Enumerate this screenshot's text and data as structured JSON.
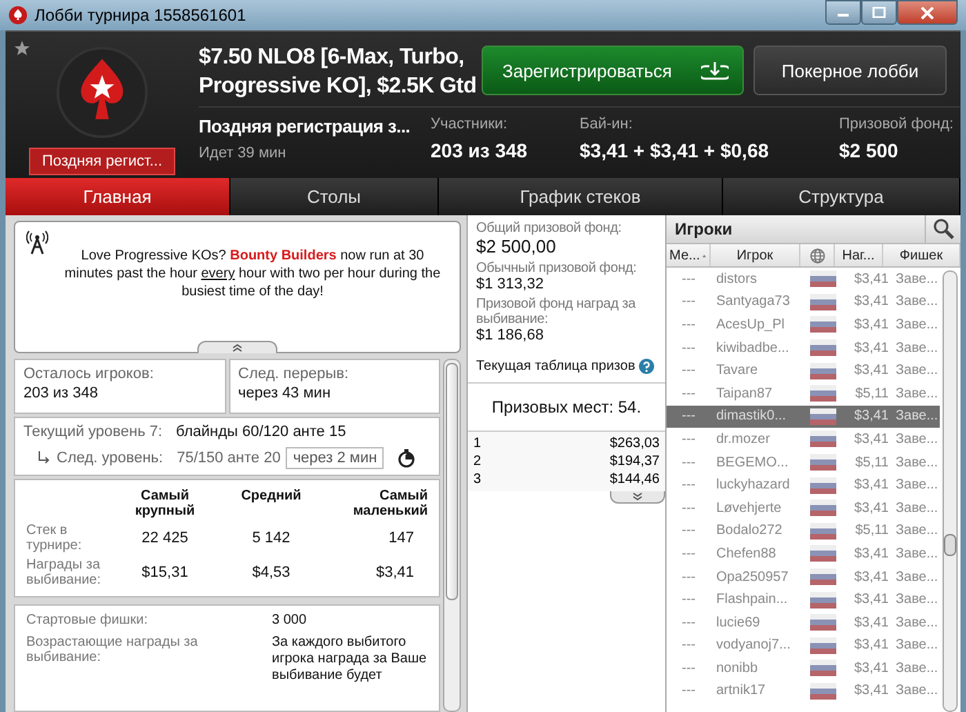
{
  "window": {
    "title": "Лобби турнира 1558561601"
  },
  "header": {
    "title_line1": "$7.50 NLO8 [6-Max, Turbo,",
    "title_line2": "Progressive KO], $2.5K Gtd",
    "status_ribbon": "Поздняя регист...",
    "late_reg": "Поздняя регистрация з...",
    "running": "Идет 39 мин",
    "register_button": "Зарегистрироваться",
    "lobby_button": "Покерное лобби",
    "stats": [
      {
        "label": "Участники:",
        "value": "203 из 348"
      },
      {
        "label": "Бай-ин:",
        "value": "$3,41 + $3,41 + $0,68"
      },
      {
        "label": "Призовой фонд:",
        "value": "$2 500"
      }
    ]
  },
  "tabs": [
    {
      "label": "Главная",
      "selected": true
    },
    {
      "label": "Столы",
      "selected": false
    },
    {
      "label": "График стеков",
      "selected": false
    },
    {
      "label": "Структура",
      "selected": false
    }
  ],
  "news": {
    "parts": [
      {
        "kind": "plain",
        "text": "Love Progressive KOs? "
      },
      {
        "kind": "highlight",
        "text": "Bounty Builders"
      },
      {
        "kind": "plain",
        "text": " now run at 30 minutes past the hour "
      },
      {
        "kind": "underline",
        "text": "every"
      },
      {
        "kind": "plain",
        "text": " hour with two per hour during the busiest time of the day!"
      }
    ]
  },
  "info_cells": [
    {
      "label": "Осталось игроков:",
      "value": "203 из 348"
    },
    {
      "label": "След. перерыв:",
      "value": "через 43 мин"
    }
  ],
  "level": {
    "current_label": "Текущий уровень 7:",
    "current_value": "блайнды 60/120 анте 15",
    "next_label": "След. уровень:",
    "next_value": "75/150 анте 20",
    "next_time": "через 2 мин"
  },
  "stack_table": {
    "columns": [
      "Самый крупный",
      "Средний",
      "Самый маленький"
    ],
    "rows": [
      {
        "label": "Стек в турнире:",
        "values": [
          "22 425",
          "5 142",
          "147"
        ]
      },
      {
        "label": "Награды за выбивание:",
        "values": [
          "$15,31",
          "$4,53",
          "$3,41"
        ]
      }
    ]
  },
  "details": [
    {
      "label": "Стартовые фишки:",
      "value": "3 000"
    },
    {
      "label": "Возрастающие награды за выбивание:",
      "value": "За каждого выбитого игрока награда за Ваше выбивание будет"
    }
  ],
  "prize_pool": [
    {
      "label": "Общий призовой фонд:",
      "value": "$2 500,00"
    },
    {
      "label": "Обычный призовой фонд:",
      "value": "$1 313,32"
    },
    {
      "label": "Призовой фонд наград за выбивание:",
      "value": "$1 186,68"
    }
  ],
  "payout_title": "Текущая таблица призов",
  "paid_places": "Призовых мест: 54.",
  "payouts": [
    {
      "place": "1",
      "amount": "$263,03"
    },
    {
      "place": "2",
      "amount": "$194,37"
    },
    {
      "place": "3",
      "amount": "$144,46"
    }
  ],
  "players": {
    "title": "Игроки",
    "columns": [
      "Ме...",
      "Игрок",
      "Наг...",
      "Фишек"
    ],
    "rows": [
      {
        "rank": "---",
        "name": "distors",
        "bounty": "$3,41",
        "chips": "Заве...",
        "selected": false
      },
      {
        "rank": "---",
        "name": "Santyaga73",
        "bounty": "$3,41",
        "chips": "Заве...",
        "selected": false
      },
      {
        "rank": "---",
        "name": "AcesUp_Pl",
        "bounty": "$3,41",
        "chips": "Заве...",
        "selected": false
      },
      {
        "rank": "---",
        "name": "kiwibadbe...",
        "bounty": "$3,41",
        "chips": "Заве...",
        "selected": false
      },
      {
        "rank": "---",
        "name": "Tavare",
        "bounty": "$3,41",
        "chips": "Заве...",
        "selected": false
      },
      {
        "rank": "---",
        "name": "Taipan87",
        "bounty": "$5,11",
        "chips": "Заве...",
        "selected": false
      },
      {
        "rank": "---",
        "name": "dimastik0...",
        "bounty": "$3,41",
        "chips": "Заве...",
        "selected": true
      },
      {
        "rank": "---",
        "name": "dr.mozer",
        "bounty": "$3,41",
        "chips": "Заве...",
        "selected": false
      },
      {
        "rank": "---",
        "name": "BEGEMO...",
        "bounty": "$5,11",
        "chips": "Заве...",
        "selected": false
      },
      {
        "rank": "---",
        "name": "luckyhazard",
        "bounty": "$3,41",
        "chips": "Заве...",
        "selected": false
      },
      {
        "rank": "---",
        "name": "Løvehjerte",
        "bounty": "$3,41",
        "chips": "Заве...",
        "selected": false
      },
      {
        "rank": "---",
        "name": "Bodalo272",
        "bounty": "$5,11",
        "chips": "Заве...",
        "selected": false
      },
      {
        "rank": "---",
        "name": "Chefen88",
        "bounty": "$3,41",
        "chips": "Заве...",
        "selected": false
      },
      {
        "rank": "---",
        "name": "Opa250957",
        "bounty": "$3,41",
        "chips": "Заве...",
        "selected": false
      },
      {
        "rank": "---",
        "name": "Flashpain...",
        "bounty": "$3,41",
        "chips": "Заве...",
        "selected": false
      },
      {
        "rank": "---",
        "name": "lucie69",
        "bounty": "$3,41",
        "chips": "Заве...",
        "selected": false
      },
      {
        "rank": "---",
        "name": "vodyanoj7...",
        "bounty": "$3,41",
        "chips": "Заве...",
        "selected": false
      },
      {
        "rank": "---",
        "name": "nonibb",
        "bounty": "$3,41",
        "chips": "Заве...",
        "selected": false
      },
      {
        "rank": "---",
        "name": "artnik17",
        "bounty": "$3,41",
        "chips": "Заве...",
        "selected": false
      }
    ]
  }
}
